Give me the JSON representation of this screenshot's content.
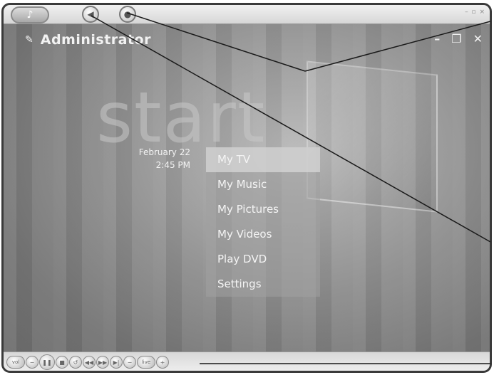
{
  "user": {
    "name": "Administrator"
  },
  "start_label": "start",
  "date": {
    "date": "February 22",
    "time": "2:45 PM"
  },
  "menu": {
    "items": [
      {
        "label": "My TV",
        "selected": true
      },
      {
        "label": "My Music"
      },
      {
        "label": "My Pictures"
      },
      {
        "label": "My Videos"
      },
      {
        "label": "Play DVD"
      },
      {
        "label": "Settings"
      }
    ]
  },
  "transport": {
    "mute_label": "vol",
    "live_label": "live"
  },
  "colors": {
    "background": "#8f8f8f",
    "menu_selected": "#d7d7d7",
    "text": "#f4f4f4"
  }
}
